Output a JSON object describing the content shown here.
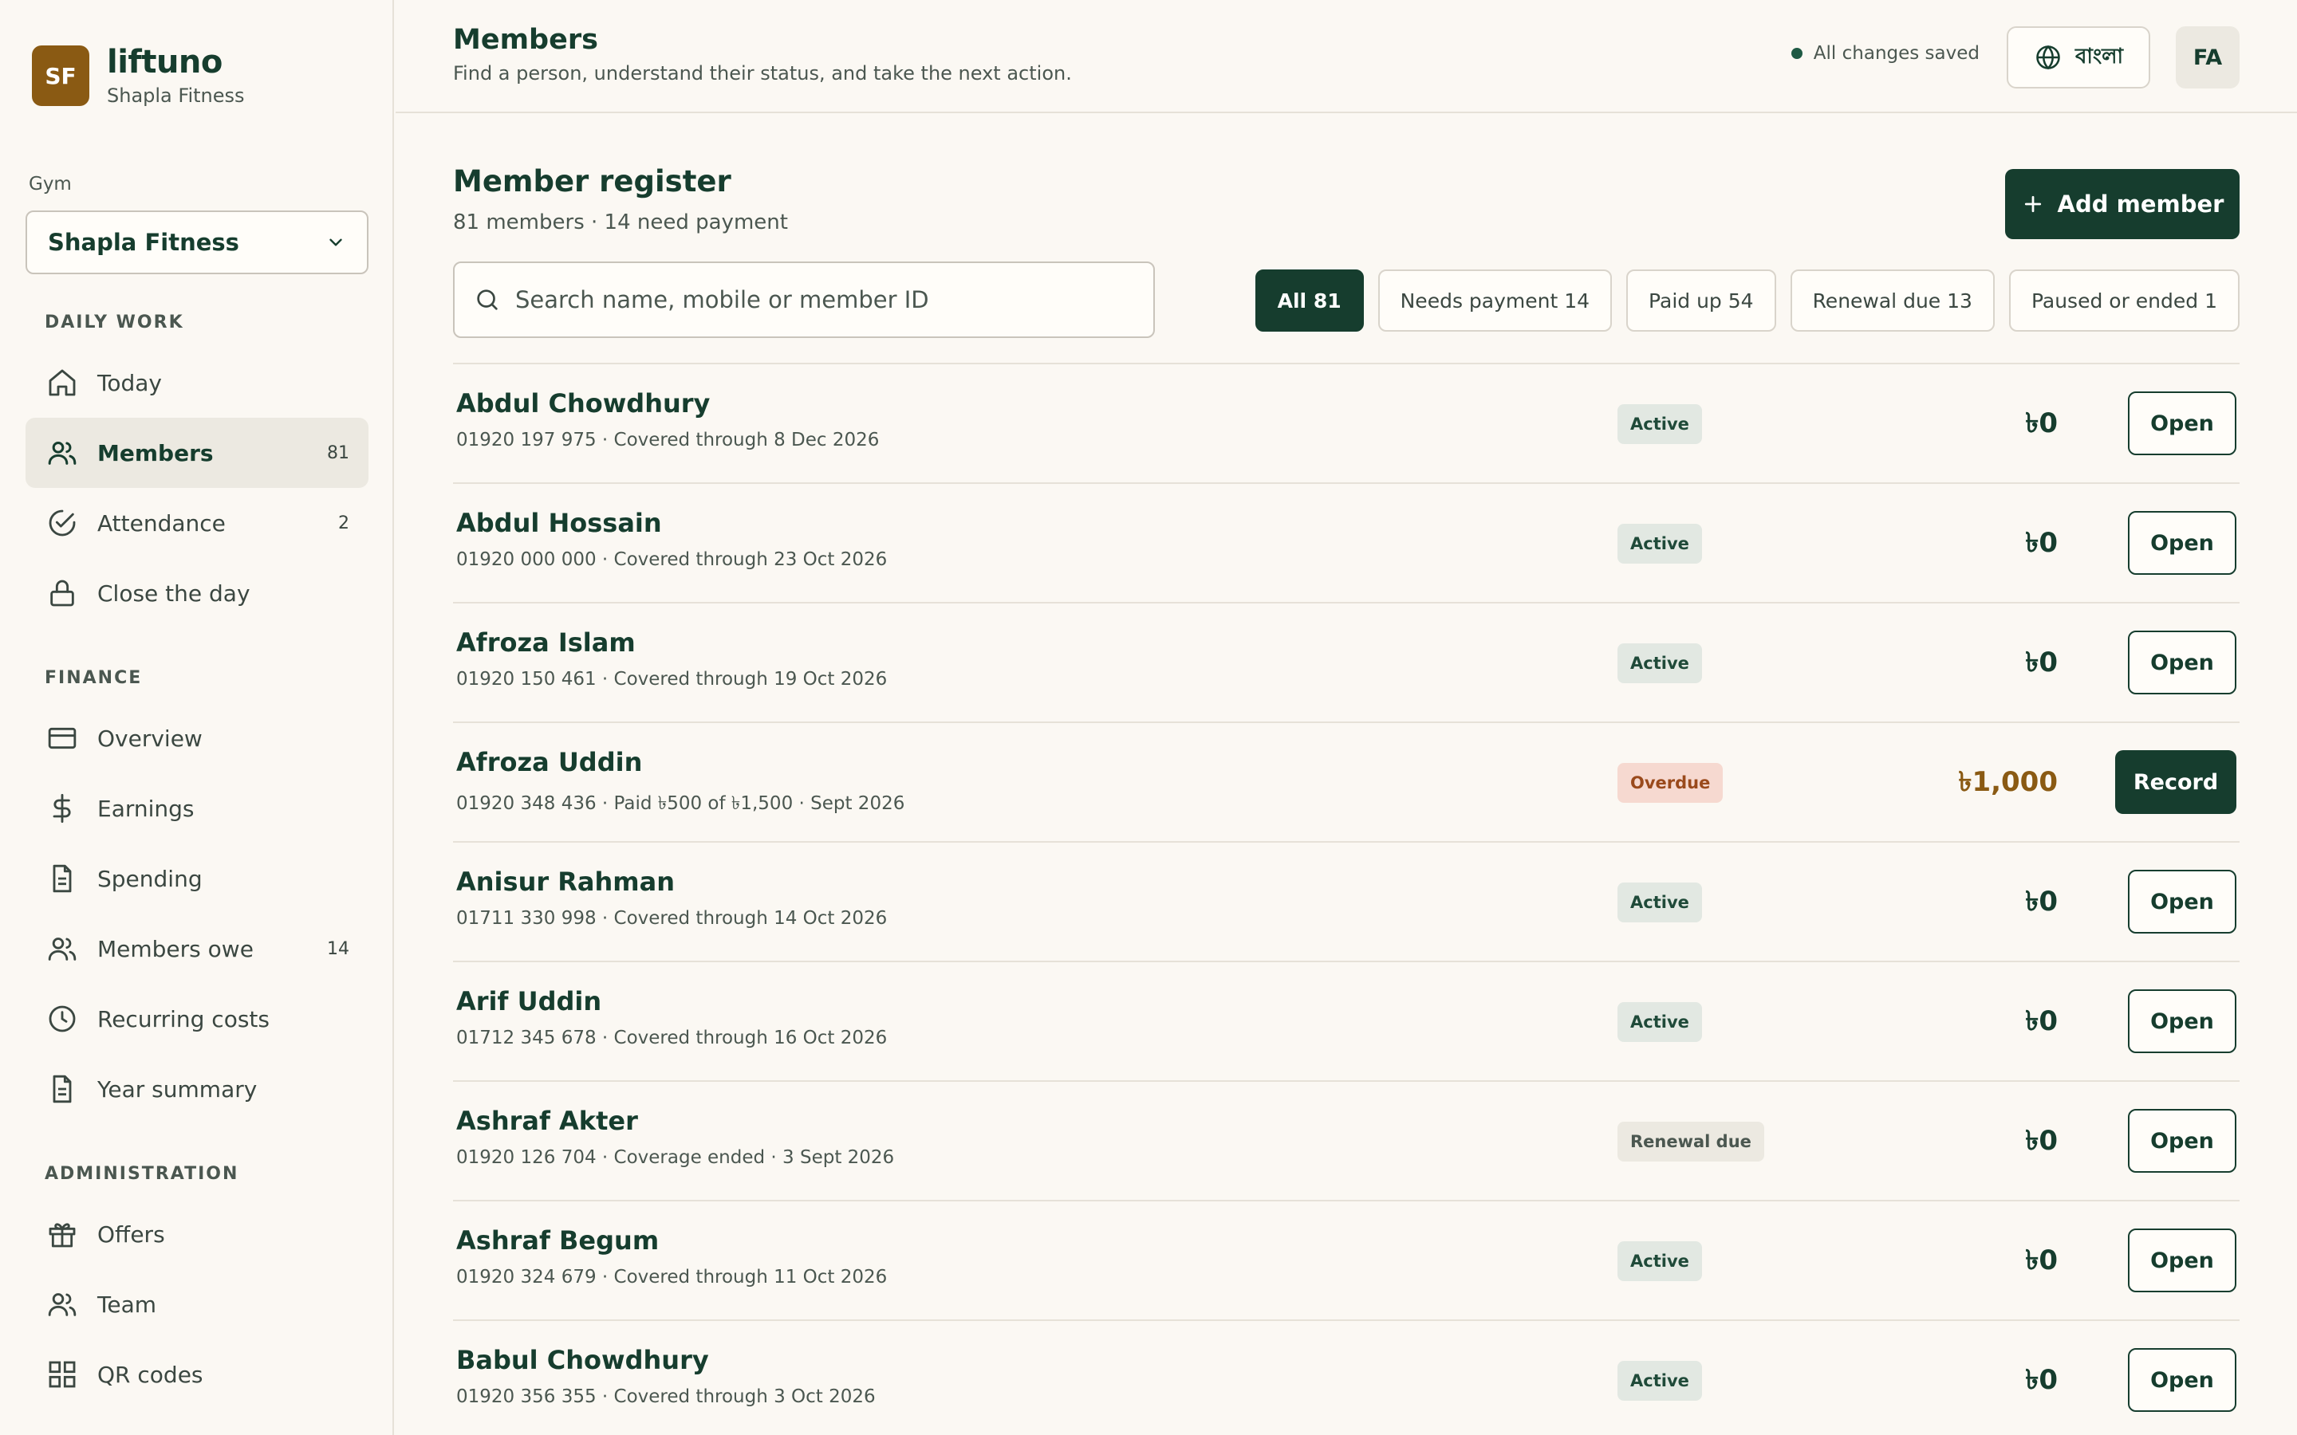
{
  "brand": {
    "logo": "SF",
    "name": "liftuno",
    "gym": "Shapla Fitness"
  },
  "gym_selector": {
    "label": "Gym",
    "value": "Shapla Fitness"
  },
  "nav": {
    "daily_title": "DAILY WORK",
    "daily": [
      {
        "label": "Today",
        "icon": "home-icon",
        "count": ""
      },
      {
        "label": "Members",
        "icon": "users-icon",
        "count": "81"
      },
      {
        "label": "Attendance",
        "icon": "check-circle-icon",
        "count": "2"
      },
      {
        "label": "Close the day",
        "icon": "lock-icon",
        "count": ""
      }
    ],
    "finance_title": "FINANCE",
    "finance": [
      {
        "label": "Overview",
        "icon": "card-icon",
        "count": ""
      },
      {
        "label": "Earnings",
        "icon": "dollar-icon",
        "count": ""
      },
      {
        "label": "Spending",
        "icon": "document-icon",
        "count": ""
      },
      {
        "label": "Members owe",
        "icon": "users-icon",
        "count": "14"
      },
      {
        "label": "Recurring costs",
        "icon": "clock-icon",
        "count": ""
      },
      {
        "label": "Year summary",
        "icon": "document-icon",
        "count": ""
      }
    ],
    "admin_title": "ADMINISTRATION",
    "admin": [
      {
        "label": "Offers",
        "icon": "gift-icon",
        "count": ""
      },
      {
        "label": "Team",
        "icon": "users-icon",
        "count": ""
      },
      {
        "label": "QR codes",
        "icon": "grid-icon",
        "count": ""
      }
    ]
  },
  "header": {
    "title": "Members",
    "subtitle": "Find a person, understand their status, and take the next action.",
    "saved_status": "All changes saved",
    "language_label": "বাংলা",
    "avatar": "FA"
  },
  "register": {
    "title": "Member register",
    "summary": "81 members · 14 need payment",
    "add_label": "Add member",
    "search_placeholder": "Search name, mobile or member ID",
    "filters": [
      "All 81",
      "Needs payment 14",
      "Paid up 54",
      "Renewal due 13",
      "Paused or ended 1"
    ],
    "members": [
      {
        "name": "Abdul Chowdhury",
        "detail": "01920 197 975 · Covered through 8 Dec 2026",
        "status": "Active",
        "amount": "৳0",
        "action": "Open"
      },
      {
        "name": "Abdul Hossain",
        "detail": "01920 000 000 · Covered through 23 Oct 2026",
        "status": "Active",
        "amount": "৳0",
        "action": "Open"
      },
      {
        "name": "Afroza Islam",
        "detail": "01920 150 461 · Covered through 19 Oct 2026",
        "status": "Active",
        "amount": "৳0",
        "action": "Open"
      },
      {
        "name": "Afroza Uddin",
        "detail": "01920 348 436 · Paid ৳500 of ৳1,500 · Sept 2026",
        "status": "Overdue",
        "amount": "৳1,000",
        "action": "Record"
      },
      {
        "name": "Anisur Rahman",
        "detail": "01711 330 998 · Covered through 14 Oct 2026",
        "status": "Active",
        "amount": "৳0",
        "action": "Open"
      },
      {
        "name": "Arif Uddin",
        "detail": "01712 345 678 · Covered through 16 Oct 2026",
        "status": "Active",
        "amount": "৳0",
        "action": "Open"
      },
      {
        "name": "Ashraf Akter",
        "detail": "01920 126 704 · Coverage ended · 3 Sept 2026",
        "status": "Renewal due",
        "amount": "৳0",
        "action": "Open"
      },
      {
        "name": "Ashraf Begum",
        "detail": "01920 324 679 · Covered through 11 Oct 2026",
        "status": "Active",
        "amount": "৳0",
        "action": "Open"
      },
      {
        "name": "Babul Chowdhury",
        "detail": "01920 356 355 · Covered through 3 Oct 2026",
        "status": "Active",
        "amount": "৳0",
        "action": "Open"
      }
    ]
  },
  "colors": {
    "primary": "#163d2e",
    "brand": "#8a5a13",
    "background": "#fbf8f3",
    "overdue_bg": "#f6d9d0"
  }
}
